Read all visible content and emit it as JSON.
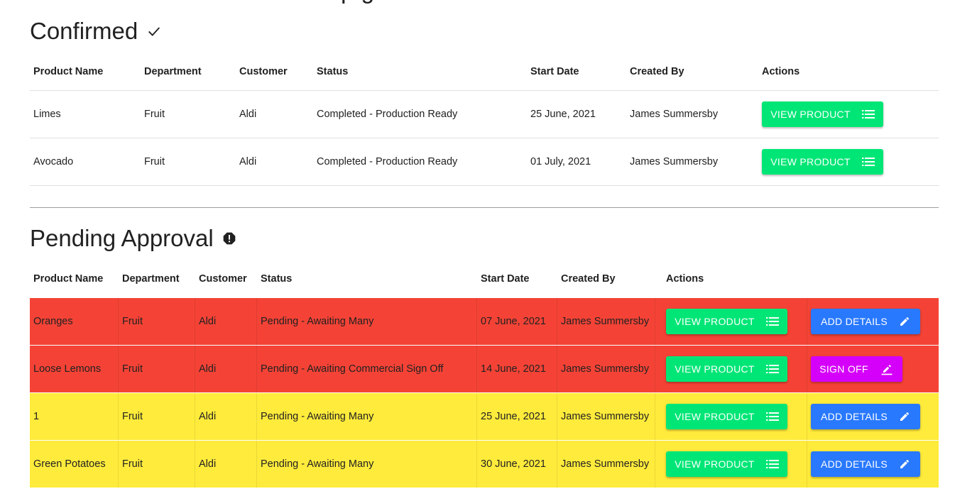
{
  "page": {
    "title_fragment": "p g"
  },
  "confirmed": {
    "title": "Confirmed",
    "title_icon": "check-icon",
    "headers": [
      "Product Name",
      "Department",
      "Customer",
      "Status",
      "Start Date",
      "Created By",
      "Actions"
    ],
    "rows": [
      {
        "product": "Limes",
        "department": "Fruit",
        "customer": "Aldi",
        "status": "Completed - Production Ready",
        "start_date": "25 June, 2021",
        "created_by": "James Summersby",
        "action": "VIEW PRODUCT"
      },
      {
        "product": "Avocado",
        "department": "Fruit",
        "customer": "Aldi",
        "status": "Completed - Production Ready",
        "start_date": "01 July, 2021",
        "created_by": "James Summersby",
        "action": "VIEW PRODUCT"
      }
    ]
  },
  "pending": {
    "title": "Pending Approval",
    "title_icon": "alert-octagon-icon",
    "headers": [
      "Product Name",
      "Department",
      "Customer",
      "Status",
      "Start Date",
      "Created By",
      "Actions"
    ],
    "rows": [
      {
        "product": "Oranges",
        "department": "Fruit",
        "customer": "Aldi",
        "status": "Pending - Awaiting Many",
        "start_date": "07 June, 2021",
        "created_by": "James Summersby",
        "action": "VIEW PRODUCT",
        "secondary_action": "ADD DETAILS",
        "secondary_icon": "pencil-icon",
        "row_color": "#f44336"
      },
      {
        "product": "Loose Lemons",
        "department": "Fruit",
        "customer": "Aldi",
        "status": "Pending - Awaiting Commercial Sign Off",
        "start_date": "14 June, 2021",
        "created_by": "James Summersby",
        "action": "VIEW PRODUCT",
        "secondary_action": "SIGN OFF",
        "secondary_icon": "draw-icon",
        "row_color": "#f44336"
      },
      {
        "product": "1",
        "department": "Fruit",
        "customer": "Aldi",
        "status": "Pending - Awaiting Many",
        "start_date": "25 June, 2021",
        "created_by": "James Summersby",
        "action": "VIEW PRODUCT",
        "secondary_action": "ADD DETAILS",
        "secondary_icon": "pencil-icon",
        "row_color": "#ffeb3b"
      },
      {
        "product": "Green Potatoes",
        "department": "Fruit",
        "customer": "Aldi",
        "status": "Pending - Awaiting Many",
        "start_date": "30 June, 2021",
        "created_by": "James Summersby",
        "action": "VIEW PRODUCT",
        "secondary_action": "ADD DETAILS",
        "secondary_icon": "pencil-icon",
        "row_color": "#ffeb3b"
      }
    ]
  },
  "colors": {
    "view_button": "#00e676",
    "add_details_button": "#2979ff",
    "sign_off_button": "#d500f9",
    "row_urgent": "#f44336",
    "row_warning": "#ffeb3b"
  },
  "icons": {
    "view_button": "list-icon"
  }
}
